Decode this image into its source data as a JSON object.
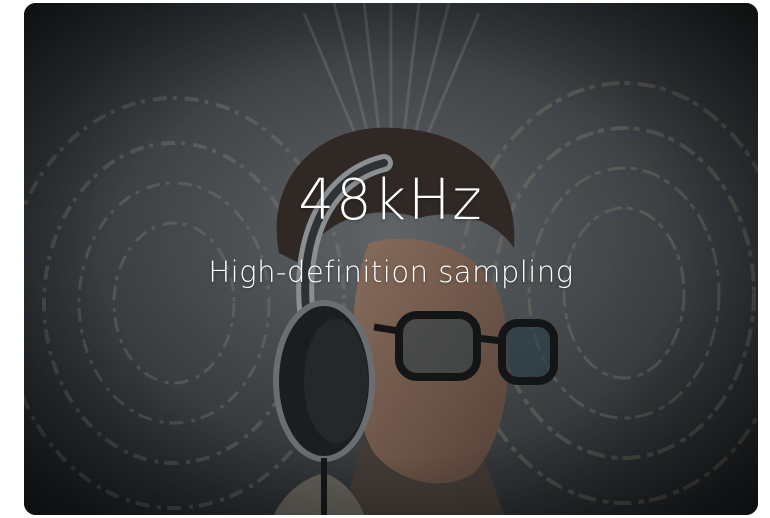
{
  "feature_card": {
    "headline": "48kHz",
    "subline": "High-definition sampling",
    "image_subject": "man wearing headphones and glasses with swirling motion-blur background",
    "colors": {
      "text": "#ffffff",
      "overlay": "#1e2124",
      "background_swirl": "#7d8084"
    },
    "icons": []
  }
}
